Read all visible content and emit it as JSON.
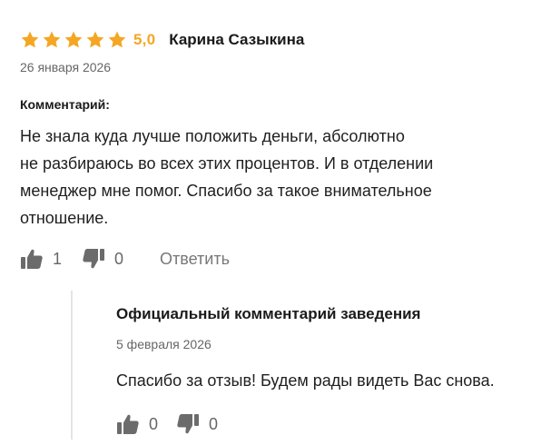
{
  "review": {
    "rating": 5,
    "rating_text": "5,0",
    "author": "Карина Сазыкина",
    "date": "26 января 2026",
    "comment_label": "Комментарий:",
    "comment_lines": [
      "Не знала куда лучше положить деньги, абсолютно",
      "не разбираюсь во всех этих процентов. И в отделении",
      "менеджер мне помог. Спасибо за такое внимательное",
      "отношение."
    ],
    "likes": "1",
    "dislikes": "0",
    "reply_label": "Ответить"
  },
  "official_reply": {
    "title": "Официальный комментарий заведения",
    "date": "5 февраля 2026",
    "text": "Спасибо за отзыв! Будем рады видеть Вас снова.",
    "likes": "0",
    "dislikes": "0"
  },
  "colors": {
    "star": "#f5a623",
    "icon": "#6b6b6b",
    "divider": "#e4e4e4"
  },
  "icons": {
    "star": "star-icon",
    "like": "thumbs-up-icon",
    "dislike": "thumbs-down-icon"
  }
}
